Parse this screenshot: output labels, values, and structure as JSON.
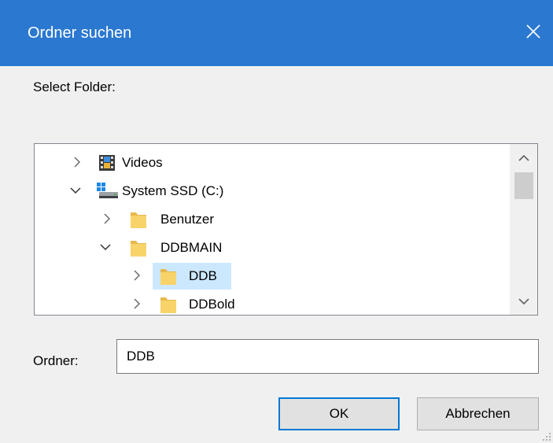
{
  "window": {
    "title": "Ordner suchen"
  },
  "prompt": "Select Folder:",
  "tree": {
    "items": [
      {
        "label": "Videos",
        "expanded": false
      },
      {
        "label": "System SSD (C:)",
        "expanded": true
      },
      {
        "label": "Benutzer",
        "expanded": false
      },
      {
        "label": "DDBMAIN",
        "expanded": true
      },
      {
        "label": "DDB",
        "expanded": false,
        "selected": true
      },
      {
        "label": "DDBold",
        "expanded": false
      }
    ]
  },
  "folder_field": {
    "label": "Ordner:",
    "value": "DDB"
  },
  "buttons": {
    "ok": "OK",
    "cancel": "Abbrechen"
  },
  "colors": {
    "titlebar": "#2b78d0",
    "selection": "#cce8ff",
    "accent": "#0078d7",
    "folder": "#f7d36a"
  }
}
